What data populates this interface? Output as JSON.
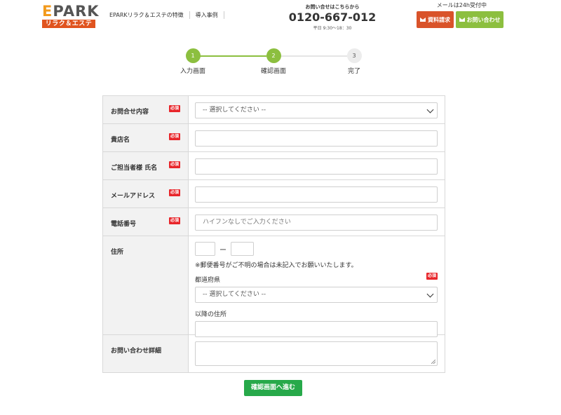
{
  "header": {
    "logo_main": "EPARK",
    "logo_sub": "リラク＆エステ",
    "nav": [
      "EPARKリラク＆エステの特徴",
      "導入事例"
    ],
    "contact_label": "お問い合せはこちらから",
    "phone": "0120-667-012",
    "hours": "平日 9:30～18：30",
    "accept_text": "メールは24h受付中",
    "request_button": "資料請求",
    "inquiry_button": "お問い合わせ"
  },
  "steps": [
    {
      "num": "1",
      "label": "入力画面",
      "state": "done"
    },
    {
      "num": "2",
      "label": "確認画面",
      "state": "active"
    },
    {
      "num": "3",
      "label": "完了",
      "state": "pending"
    }
  ],
  "form": {
    "required_badge": "必須",
    "inquiry_type": {
      "label": "お問合せ内容",
      "value": "-- 選択してください --"
    },
    "shop_name": {
      "label": "貴店名",
      "value": ""
    },
    "contact_name": {
      "label": "ご担当者様 氏名",
      "value": ""
    },
    "email": {
      "label": "メールアドレス",
      "value": ""
    },
    "phone": {
      "label": "電話番号",
      "placeholder": "ハイフンなしでご入力ください"
    },
    "address": {
      "label": "住所",
      "zip_separator": "ー",
      "note": "※郵便番号がご不明の場合は未記入でお願いいたします。",
      "prefecture_label": "都道府県",
      "prefecture_value": "-- 選択してください --",
      "rest_label": "以降の住所"
    },
    "details": {
      "label": "お問い合わせ詳細",
      "value": ""
    },
    "submit": "確認画面へ進む"
  },
  "colors": {
    "brand_orange": "#e0541f",
    "green": "#8cbf3f",
    "submit_green": "#27a94a",
    "required_red": "#e8262b"
  }
}
